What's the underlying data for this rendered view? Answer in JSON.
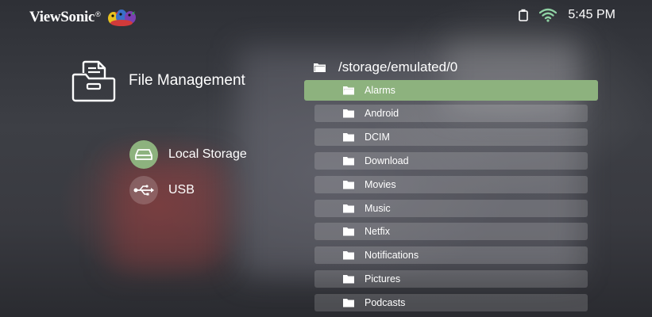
{
  "brand": {
    "name": "ViewSonic",
    "registered": "®"
  },
  "status": {
    "time": "5:45 PM"
  },
  "header": {
    "title": "File Management"
  },
  "storage": [
    {
      "label": "Local Storage",
      "icon": "hard-drive-icon",
      "active": true
    },
    {
      "label": "USB",
      "icon": "usb-icon",
      "active": false
    }
  ],
  "path": "/storage/emulated/0",
  "files": [
    {
      "name": "Alarms",
      "selected": true
    },
    {
      "name": "Android",
      "selected": false
    },
    {
      "name": "DCIM",
      "selected": false
    },
    {
      "name": "Download",
      "selected": false
    },
    {
      "name": "Movies",
      "selected": false
    },
    {
      "name": "Music",
      "selected": false
    },
    {
      "name": "Netfix",
      "selected": false
    },
    {
      "name": "Notifications",
      "selected": false
    },
    {
      "name": "Pictures",
      "selected": false
    },
    {
      "name": "Podcasts",
      "selected": false
    }
  ],
  "colors": {
    "accent": "#8db27e",
    "row": "rgba(255,255,255,0.16)"
  }
}
